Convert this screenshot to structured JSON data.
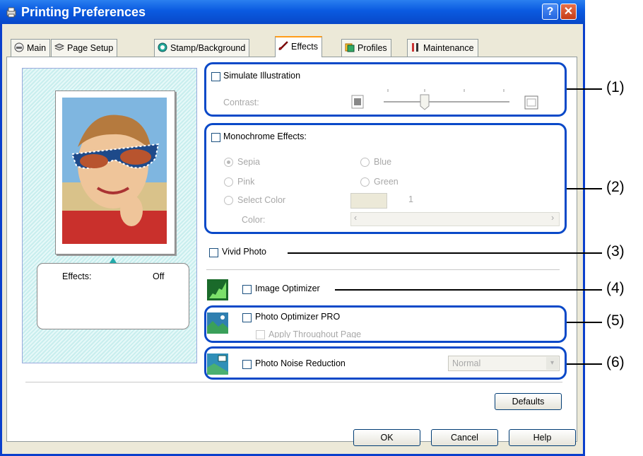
{
  "window": {
    "title": "Printing Preferences",
    "title_bar_color": "#0a5ae0",
    "help_glyph": "?",
    "close_glyph": "✕"
  },
  "tabs": [
    {
      "label": "Main",
      "icon": "printer-icon",
      "active": false
    },
    {
      "label": "Page Setup",
      "icon": "stack-icon",
      "active": false
    },
    {
      "label": "Stamp/Background",
      "icon": "stamp-icon",
      "active": false
    },
    {
      "label": "Effects",
      "icon": "brush-icon",
      "active": true
    },
    {
      "label": "Profiles",
      "icon": "profiles-icon",
      "active": false
    },
    {
      "label": "Maintenance",
      "icon": "tools-icon",
      "active": false
    }
  ],
  "preview": {
    "effects_label": "Effects:",
    "effects_value": "Off"
  },
  "simulate_illustration": {
    "label": "Simulate Illustration",
    "checked": false,
    "contrast_label": "Contrast:"
  },
  "monochrome": {
    "label": "Monochrome Effects:",
    "checked": false,
    "options": {
      "sepia": "Sepia",
      "blue": "Blue",
      "pink": "Pink",
      "green": "Green",
      "select_color": "Select Color"
    },
    "select_color_value": "1",
    "color_label": "Color:"
  },
  "vivid_photo": {
    "label": "Vivid Photo",
    "checked": false
  },
  "image_optimizer": {
    "label": "Image Optimizer",
    "checked": false
  },
  "photo_optimizer": {
    "label": "Photo Optimizer PRO",
    "checked": false,
    "apply_label": "Apply Throughout Page"
  },
  "noise_reduction": {
    "label": "Photo Noise Reduction",
    "checked": false,
    "level": "Normal"
  },
  "buttons": {
    "defaults": "Defaults",
    "ok": "OK",
    "cancel": "Cancel",
    "help": "Help"
  },
  "annotations": [
    "(1)",
    "(2)",
    "(3)",
    "(4)",
    "(5)",
    "(6)"
  ],
  "highlight_color": "#0a49c8"
}
